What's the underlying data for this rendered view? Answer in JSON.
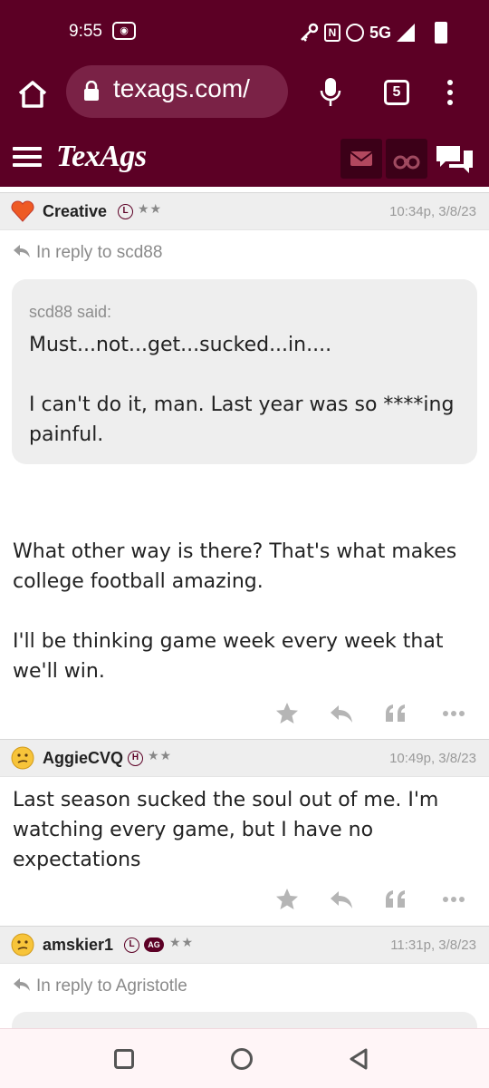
{
  "statusbar": {
    "time": "9:55",
    "network": "5G"
  },
  "browser": {
    "url": "texags.com/",
    "tab_count": "5"
  },
  "site": {
    "logo": "TexAgs"
  },
  "posts": [
    {
      "username": "Creative",
      "badge": "L",
      "stars": "★★",
      "timestamp": "10:34p, 3/8/23",
      "reply_to": "In reply to scd88",
      "quote": {
        "author": "scd88 said:",
        "paragraphs": [
          "Must...not...get...sucked...in....",
          "I can't do it, man. Last year was so ****ing painful."
        ]
      },
      "paragraphs": [
        "What other way is there? That's what makes college football amazing.",
        "I'll be thinking game week every week that we'll win."
      ]
    },
    {
      "username": "AggieCVQ",
      "badge": "H",
      "stars": "★★",
      "timestamp": "10:49p, 3/8/23",
      "paragraphs": [
        "Last season sucked the soul out of me. I'm watching every game, but I have no expectations"
      ]
    },
    {
      "username": "amskier1",
      "badge": "L",
      "badge2": "AG",
      "stars": "★★",
      "timestamp": "11:31p, 3/8/23",
      "reply_to": "In reply to Agristotle"
    }
  ],
  "colors": {
    "brand": "#5c0025",
    "header_box": "#3c0018",
    "post_header_bg": "#eeeeee",
    "muted_text": "#8a8a8a",
    "action_icon": "#b5b5b5"
  }
}
